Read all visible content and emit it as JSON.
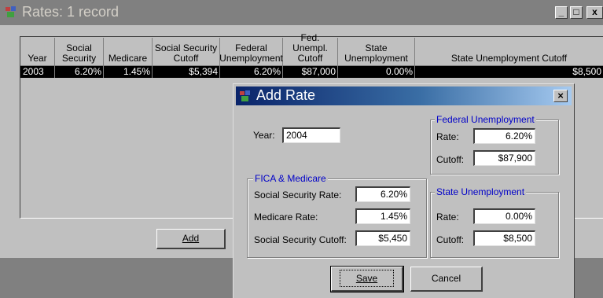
{
  "main_window": {
    "title": "Rates: 1 record",
    "minimize_glyph": "_",
    "maximize_glyph": "□",
    "close_glyph": "x"
  },
  "grid": {
    "columns": [
      "Year",
      "Social Security",
      "Medicare",
      "Social Security Cutoff",
      "Federal Unemployment",
      "Fed. Unempl. Cutoff",
      "State Unemployment",
      "State Unemployment Cutoff"
    ],
    "rows": [
      [
        "2003",
        "6.20%",
        "1.45%",
        "$5,394",
        "6.20%",
        "$87,000",
        "0.00%",
        "$8,500"
      ]
    ]
  },
  "add_button": {
    "label": "Add",
    "accel_index": 0
  },
  "dialog": {
    "title": "Add Rate",
    "close_glyph": "×",
    "year_label": "Year:",
    "year_value": "2004",
    "fica_group": {
      "legend": "FICA & Medicare",
      "ss_rate_label": "Social Security Rate:",
      "ss_rate_value": "6.20%",
      "medicare_label": "Medicare Rate:",
      "medicare_value": "1.45%",
      "ss_cutoff_label": "Social Security Cutoff:",
      "ss_cutoff_value": "$5,450"
    },
    "federal_group": {
      "legend": "Federal Unemployment",
      "rate_label": "Rate:",
      "rate_value": "6.20%",
      "cutoff_label": "Cutoff:",
      "cutoff_value": "$87,900"
    },
    "state_group": {
      "legend": "State Unemployment",
      "rate_label": "Rate:",
      "rate_value": "0.00%",
      "cutoff_label": "Cutoff:",
      "cutoff_value": "$8,500"
    },
    "save_label": "Save",
    "cancel_label": "Cancel"
  },
  "colors": {
    "dialog_title_start": "#0a246a",
    "dialog_title_end": "#a6caf0",
    "group_legend": "#0000c8",
    "inactive_title": "#808080",
    "selected_row": "#000000"
  }
}
